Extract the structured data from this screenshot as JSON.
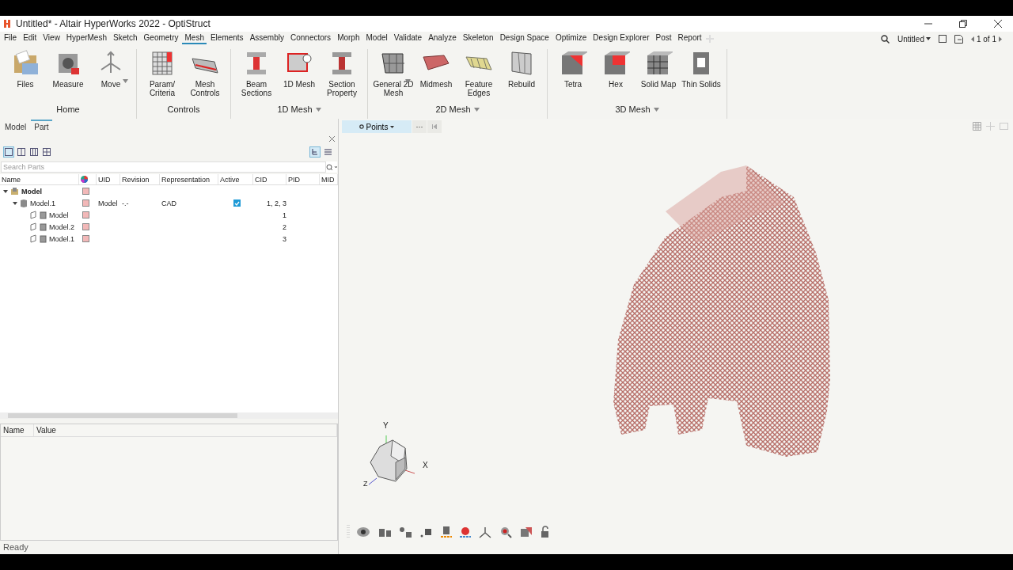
{
  "window": {
    "title": "Untitled* - Altair HyperWorks 2022 - OptiStruct"
  },
  "menu": [
    {
      "label": "File",
      "selected": false
    },
    {
      "label": "Edit",
      "selected": false
    },
    {
      "label": "View",
      "selected": false
    },
    {
      "label": "HyperMesh",
      "selected": false
    },
    {
      "label": "Sketch",
      "selected": false
    },
    {
      "label": "Geometry",
      "selected": false
    },
    {
      "label": "Mesh",
      "selected": true
    },
    {
      "label": "Elements",
      "selected": false
    },
    {
      "label": "Assembly",
      "selected": false
    },
    {
      "label": "Connectors",
      "selected": false
    },
    {
      "label": "Morph",
      "selected": false
    },
    {
      "label": "Model",
      "selected": false
    },
    {
      "label": "Validate",
      "selected": false
    },
    {
      "label": "Analyze",
      "selected": false
    },
    {
      "label": "Skeleton",
      "selected": false
    },
    {
      "label": "Design Space",
      "selected": false
    },
    {
      "label": "Optimize",
      "selected": false
    },
    {
      "label": "Design Explorer",
      "selected": false
    },
    {
      "label": "Post",
      "selected": false
    },
    {
      "label": "Report",
      "selected": false
    }
  ],
  "session": {
    "label": "Untitled",
    "page": "1 of 1"
  },
  "ribbon": [
    {
      "title": "Home",
      "dropdown": false,
      "tools": [
        {
          "lines": [
            "Files"
          ],
          "dropdown": false
        },
        {
          "lines": [
            "Measure"
          ],
          "dropdown": false
        },
        {
          "lines": [
            "Move"
          ],
          "dropdown": true
        }
      ]
    },
    {
      "title": "Controls",
      "dropdown": false,
      "tools": [
        {
          "lines": [
            "Param/",
            "Criteria"
          ],
          "dropdown": false
        },
        {
          "lines": [
            "Mesh",
            "Controls"
          ],
          "dropdown": false
        }
      ]
    },
    {
      "title": "1D Mesh",
      "dropdown": true,
      "tools": [
        {
          "lines": [
            "Beam",
            "Sections"
          ],
          "dropdown": false
        },
        {
          "lines": [
            "1D Mesh"
          ],
          "dropdown": false
        },
        {
          "lines": [
            "Section",
            "Property"
          ],
          "dropdown": false
        }
      ]
    },
    {
      "title": "2D Mesh",
      "dropdown": true,
      "tools": [
        {
          "lines": [
            "General 2D",
            "Mesh"
          ],
          "dropdown": true
        },
        {
          "lines": [
            "Midmesh"
          ],
          "dropdown": false
        },
        {
          "lines": [
            "Feature",
            "Edges"
          ],
          "dropdown": false
        },
        {
          "lines": [
            "Rebuild"
          ],
          "dropdown": false
        }
      ]
    },
    {
      "title": "3D Mesh",
      "dropdown": true,
      "tools": [
        {
          "lines": [
            "Tetra"
          ],
          "dropdown": false
        },
        {
          "lines": [
            "Hex"
          ],
          "dropdown": false
        },
        {
          "lines": [
            "Solid Map"
          ],
          "dropdown": false
        },
        {
          "lines": [
            "Thin Solids"
          ],
          "dropdown": false
        }
      ]
    }
  ],
  "browser": {
    "tabs": [
      {
        "label": "Model",
        "selected": false
      },
      {
        "label": "Part",
        "selected": true
      }
    ],
    "layout_buttons": [
      {
        "selected": true
      },
      {
        "selected": false
      },
      {
        "selected": false
      },
      {
        "selected": false
      }
    ],
    "display_buttons": [
      {
        "selected": true
      },
      {
        "selected": false
      }
    ],
    "search": {
      "placeholder": "Search Parts"
    },
    "columns": [
      {
        "kind": "text",
        "label": "Name"
      },
      {
        "kind": "color"
      },
      {
        "kind": "text",
        "label": "UID"
      },
      {
        "kind": "text",
        "label": "Revision"
      },
      {
        "kind": "text",
        "label": "Representation"
      },
      {
        "kind": "text",
        "label": "Active"
      },
      {
        "kind": "text",
        "label": "CID"
      },
      {
        "kind": "text",
        "label": "PID"
      },
      {
        "kind": "text",
        "label": "MID"
      }
    ],
    "tree": [
      {
        "name": "Model",
        "color": "#f2b8b8",
        "expanded": true,
        "children": [
          {
            "name": "Model.1",
            "color": "#f2b8b8",
            "expanded": true,
            "uid": "Model",
            "revision": "-.-",
            "representation": "CAD",
            "active": true,
            "cid": "1, 2, 3",
            "children": [
              {
                "name": "Model",
                "color": "#f2b8b8",
                "cid": "1"
              },
              {
                "name": "Model.2",
                "color": "#f2b8b8",
                "cid": "2"
              },
              {
                "name": "Model.1",
                "color": "#f2b8b8",
                "cid": "3"
              }
            ]
          }
        ]
      }
    ]
  },
  "properties": {
    "columns": [
      "Name",
      "Value"
    ]
  },
  "status_bar": {
    "text": "Ready"
  },
  "viewport": {
    "display_mode": "Points",
    "more": "···",
    "axes": {
      "y": "Y",
      "x": "X",
      "z": "Z"
    }
  }
}
